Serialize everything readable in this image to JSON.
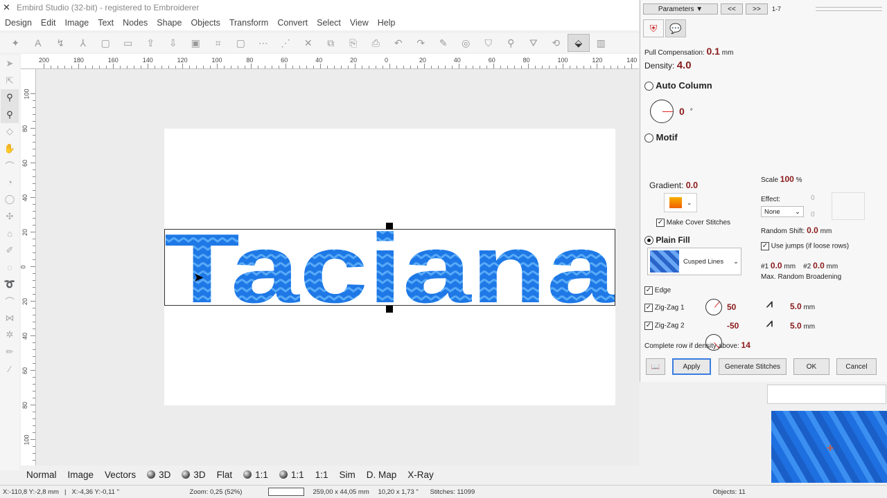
{
  "window": {
    "title": "Embird Studio (32-bit)  - registered to Embroiderer"
  },
  "menu": [
    "Design",
    "Edit",
    "Image",
    "Text",
    "Nodes",
    "Shape",
    "Objects",
    "Transform",
    "Convert",
    "Select",
    "View",
    "Help"
  ],
  "toolbar_icons": [
    "wand-icon",
    "text-icon",
    "text-on-path-icon",
    "text-vertical-icon",
    "new-page-icon",
    "open-icon",
    "import-icon",
    "export-icon",
    "save-icon",
    "frame-icon",
    "rectangle-icon",
    "select-nodes-icon",
    "distribute-icon",
    "cut-icon",
    "copy-icon",
    "paste-icon",
    "paste-special-icon",
    "undo-icon",
    "redo-icon",
    "pen-icon",
    "eye-icon",
    "shirt-icon",
    "eyedropper-icon",
    "fill-tool-icon",
    "transform-icon",
    "color-fill-icon",
    "sidebar-icon"
  ],
  "left_tools": [
    "pointer-icon",
    "node-edit-icon",
    "zoom-icon",
    "zoom-one-icon",
    "eraser-icon",
    "hand-icon",
    "lasso-icon",
    "spiral-icon",
    "circle-icon",
    "puzzle-icon",
    "tag-icon",
    "pen-path-icon",
    "ring-icon",
    "spring-icon",
    "curve-icon",
    "network-icon",
    "snowflake-icon",
    "pencil-icon",
    "line-icon"
  ],
  "rulers": {
    "horizontal": [
      "200",
      "180",
      "160",
      "140",
      "120",
      "100",
      "80",
      "60",
      "40",
      "20",
      "0",
      "20",
      "40",
      "60",
      "80",
      "100",
      "120",
      "140"
    ],
    "vertical": [
      "100",
      "80",
      "60",
      "40",
      "20",
      "0",
      "20",
      "40",
      "60",
      "80",
      "100"
    ]
  },
  "design": {
    "text": "Taciana",
    "fill_color": "#1e78e6",
    "fill_color_light": "#4aa0f5"
  },
  "viewbar": {
    "normal": "Normal",
    "image": "Image",
    "vectors": "Vectors",
    "three_d_a": "3D",
    "three_d_b": "3D",
    "flat": "Flat",
    "ratio_a": "1:1",
    "ratio_b": "1:1",
    "ratio_c": "1:1",
    "sim": "Sim",
    "dmap": "D. Map",
    "xray": "X-Ray"
  },
  "statusbar": {
    "coords_mm": "X:-110,8  Y:-2,8 mm",
    "coords_in": "X:-4,36  Y:-0,11 \"",
    "zoom": "Zoom: 0,25 (52%)",
    "size_mm": "259,00 x 44,05 mm",
    "size_in": "10,20 x 1,73 \"",
    "stitches": "Stitches: 11099",
    "objects": "Objects: 11"
  },
  "panel": {
    "parameters_label": "Parameters",
    "prev_label": "<<",
    "next_label": ">>",
    "range": "1-7",
    "pull_comp_label": "Pull Compensation:",
    "pull_comp_value": "0.1",
    "pull_comp_unit": "mm",
    "density_label": "Density:",
    "density_value": "4.0",
    "auto_column_label": "Auto Column",
    "angle_value": "0",
    "angle_unit": "°",
    "motif_label": "Motif",
    "scale_label": "Scale",
    "scale_value": "100",
    "scale_unit": "%",
    "gradient_label": "Gradient:",
    "gradient_value": "0.0",
    "effect_label": "Effect:",
    "effect_value": "None",
    "effect_num_top": "0",
    "effect_num_bottom": "0",
    "make_cover_label": "Make Cover Stitches",
    "random_shift_label": "Random Shift:",
    "random_shift_value": "0.0",
    "random_shift_unit": "mm",
    "plain_fill_label": "Plain Fill",
    "fill_type": "Cusped Lines",
    "use_jumps_label": "Use jumps (if loose rows)",
    "n1_label": "#1",
    "n1_value": "0.0",
    "n1_unit": "mm",
    "n2_label": "#2",
    "n2_value": "0.0",
    "n2_unit": "mm",
    "max_random_label": "Max. Random Broadening",
    "edge_label": "Edge",
    "zz1_label": "Zig-Zag 1",
    "zz1_value": "50",
    "zz1_len": "5.0",
    "zz1_unit": "mm",
    "zz2_label": "Zig-Zag 2",
    "zz2_value": "-50",
    "zz2_len": "5.0",
    "zz2_unit": "mm",
    "complete_row_label": "Complete row if density above:",
    "complete_row_value": "14",
    "apply": "Apply",
    "generate": "Generate Stitches",
    "ok": "OK",
    "cancel": "Cancel"
  }
}
